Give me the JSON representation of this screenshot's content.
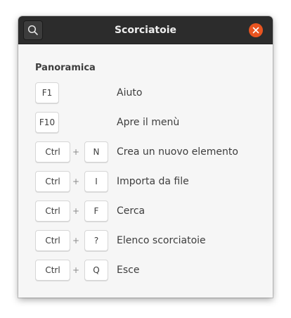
{
  "window": {
    "title": "Scorciatoie"
  },
  "icons": {
    "search": "search-icon",
    "close": "close-icon"
  },
  "colors": {
    "titlebar": "#2c2c2c",
    "close_button": "#e95420",
    "background": "#f6f6f6"
  },
  "section": {
    "title": "Panoramica"
  },
  "shortcuts": [
    {
      "keys": [
        "F1"
      ],
      "description": "Aiuto"
    },
    {
      "keys": [
        "F10"
      ],
      "description": "Apre il menù"
    },
    {
      "keys": [
        "Ctrl",
        "N"
      ],
      "description": "Crea un nuovo elemento"
    },
    {
      "keys": [
        "Ctrl",
        "I"
      ],
      "description": "Importa da file"
    },
    {
      "keys": [
        "Ctrl",
        "F"
      ],
      "description": "Cerca"
    },
    {
      "keys": [
        "Ctrl",
        "?"
      ],
      "description": "Elenco scorciatoie"
    },
    {
      "keys": [
        "Ctrl",
        "Q"
      ],
      "description": "Esce"
    }
  ],
  "separator": "+"
}
